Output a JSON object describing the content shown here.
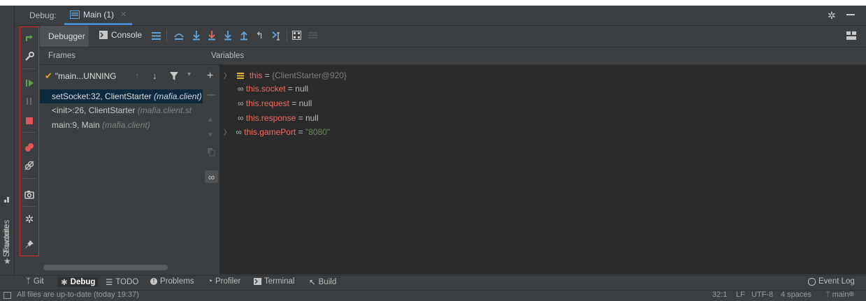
{
  "window": {
    "debug_label": "Debug:",
    "run_tab": "Main (1)"
  },
  "left_stripe": {
    "structure_label": "Structure",
    "favorites_label": "Favorites"
  },
  "action_column": {
    "icons": [
      "rerun-icon",
      "wrench-icon",
      "resume-icon",
      "pause-icon",
      "stop-icon",
      "view-breakpoints-icon",
      "mute-breakpoints-icon",
      "camera-icon",
      "settings-icon",
      "pin-icon"
    ]
  },
  "toolbar": {
    "debugger_tab": "Debugger",
    "console_tab": "Console"
  },
  "frames": {
    "header": "Frames",
    "thread_label": "\"main...UNNING",
    "rows": [
      {
        "method": "setSocket:32, ClientStarter",
        "pkg": "(mafia.client)",
        "selected": true
      },
      {
        "method": "<init>:26, ClientStarter",
        "pkg": "(mafia.client.st",
        "selected": false
      },
      {
        "method": "main:9, Main",
        "pkg": "(mafia.client)",
        "selected": false
      }
    ]
  },
  "variables": {
    "header": "Variables",
    "rows": [
      {
        "name": "this",
        "eq": " = ",
        "value": "{ClientStarter@920}",
        "expandable": true
      },
      {
        "name": "this.socket",
        "eq": " = ",
        "value": "null",
        "expandable": false
      },
      {
        "name": "this.request",
        "eq": " = ",
        "value": "null",
        "expandable": false
      },
      {
        "name": "this.response",
        "eq": " = ",
        "value": "null",
        "expandable": false
      },
      {
        "name": "this.gamePort",
        "eq": " = ",
        "value": "\"8080\"",
        "expandable": true
      }
    ]
  },
  "bottom_tabs": {
    "git": "Git",
    "debug": "Debug",
    "todo": "TODO",
    "problems": "Problems",
    "profiler": "Profiler",
    "terminal": "Terminal",
    "build": "Build",
    "event_log": "Event Log"
  },
  "status": {
    "message": "All files are up-to-date (today 19:37)",
    "position": "32:1",
    "line_sep": "LF",
    "encoding": "UTF-8",
    "indent": "4 spaces",
    "branch": "main"
  },
  "colors": {
    "bg": "#3c3f41",
    "editor_bg": "#2b2b2b",
    "selection": "#0d293e",
    "accent_blue": "#4a88c7",
    "highlight_border": "#e0262a",
    "var_name": "#e06c75",
    "string": "#6a8759"
  }
}
